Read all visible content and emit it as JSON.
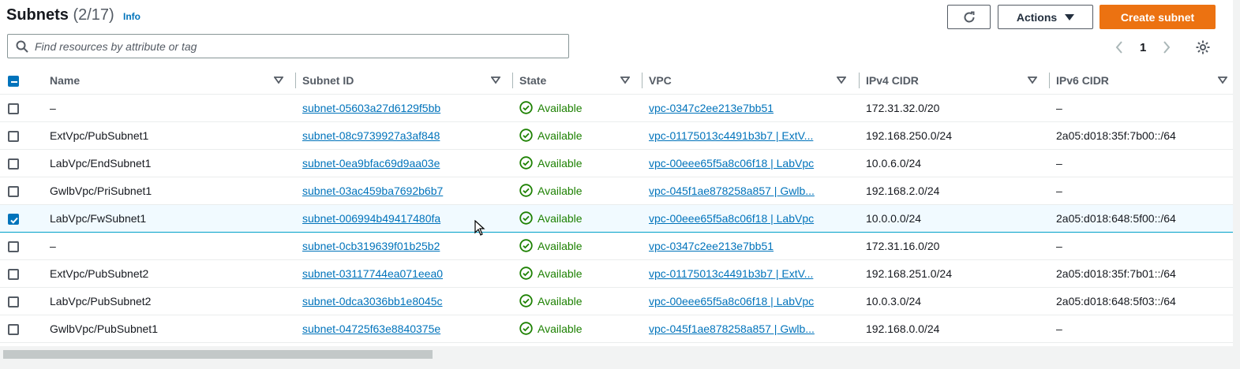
{
  "header": {
    "title": "Subnets",
    "count": "(2/17)",
    "info": "Info"
  },
  "toolbar": {
    "refresh_icon": "refresh-icon",
    "actions_label": "Actions",
    "create_label": "Create subnet"
  },
  "search": {
    "placeholder": "Find resources by attribute or tag",
    "value": ""
  },
  "pagination": {
    "current_page": "1"
  },
  "table": {
    "columns": [
      "Name",
      "Subnet ID",
      "State",
      "VPC",
      "IPv4 CIDR",
      "IPv6 CIDR"
    ],
    "rows": [
      {
        "name": "–",
        "subnet_id": "subnet-05603a27d6129f5bb",
        "state": "Available",
        "vpc": "vpc-0347c2ee213e7bb51",
        "ipv4": "172.31.32.0/20",
        "ipv6": "–",
        "selected": false
      },
      {
        "name": "ExtVpc/PubSubnet1",
        "subnet_id": "subnet-08c9739927a3af848",
        "state": "Available",
        "vpc": "vpc-01175013c4491b3b7 | ExtV...",
        "ipv4": "192.168.250.0/24",
        "ipv6": "2a05:d018:35f:7b00::/64",
        "selected": false
      },
      {
        "name": "LabVpc/EndSubnet1",
        "subnet_id": "subnet-0ea9bfac69d9aa03e",
        "state": "Available",
        "vpc": "vpc-00eee65f5a8c06f18 | LabVpc",
        "ipv4": "10.0.6.0/24",
        "ipv6": "–",
        "selected": false
      },
      {
        "name": "GwlbVpc/PriSubnet1",
        "subnet_id": "subnet-03ac459ba7692b6b7",
        "state": "Available",
        "vpc": "vpc-045f1ae878258a857 | Gwlb...",
        "ipv4": "192.168.2.0/24",
        "ipv6": "–",
        "selected": false
      },
      {
        "name": "LabVpc/FwSubnet1",
        "subnet_id": "subnet-006994b49417480fa",
        "state": "Available",
        "vpc": "vpc-00eee65f5a8c06f18 | LabVpc",
        "ipv4": "10.0.0.0/24",
        "ipv6": "2a05:d018:648:5f00::/64",
        "selected": true
      },
      {
        "name": "–",
        "subnet_id": "subnet-0cb319639f01b25b2",
        "state": "Available",
        "vpc": "vpc-0347c2ee213e7bb51",
        "ipv4": "172.31.16.0/20",
        "ipv6": "–",
        "selected": false
      },
      {
        "name": "ExtVpc/PubSubnet2",
        "subnet_id": "subnet-03117744ea071eea0",
        "state": "Available",
        "vpc": "vpc-01175013c4491b3b7 | ExtV...",
        "ipv4": "192.168.251.0/24",
        "ipv6": "2a05:d018:35f:7b01::/64",
        "selected": false
      },
      {
        "name": "LabVpc/PubSubnet2",
        "subnet_id": "subnet-0dca3036bb1e8045c",
        "state": "Available",
        "vpc": "vpc-00eee65f5a8c06f18 | LabVpc",
        "ipv4": "10.0.3.0/24",
        "ipv6": "2a05:d018:648:5f03::/64",
        "selected": false
      },
      {
        "name": "GwlbVpc/PubSubnet1",
        "subnet_id": "subnet-04725f63e8840375e",
        "state": "Available",
        "vpc": "vpc-045f1ae878258a857 | Gwlb...",
        "ipv4": "192.168.0.0/24",
        "ipv6": "–",
        "selected": false
      }
    ]
  },
  "colors": {
    "primary_button": "#ec7211",
    "link": "#0073bb",
    "available": "#1d8102",
    "selected_row": "#f1faff"
  }
}
